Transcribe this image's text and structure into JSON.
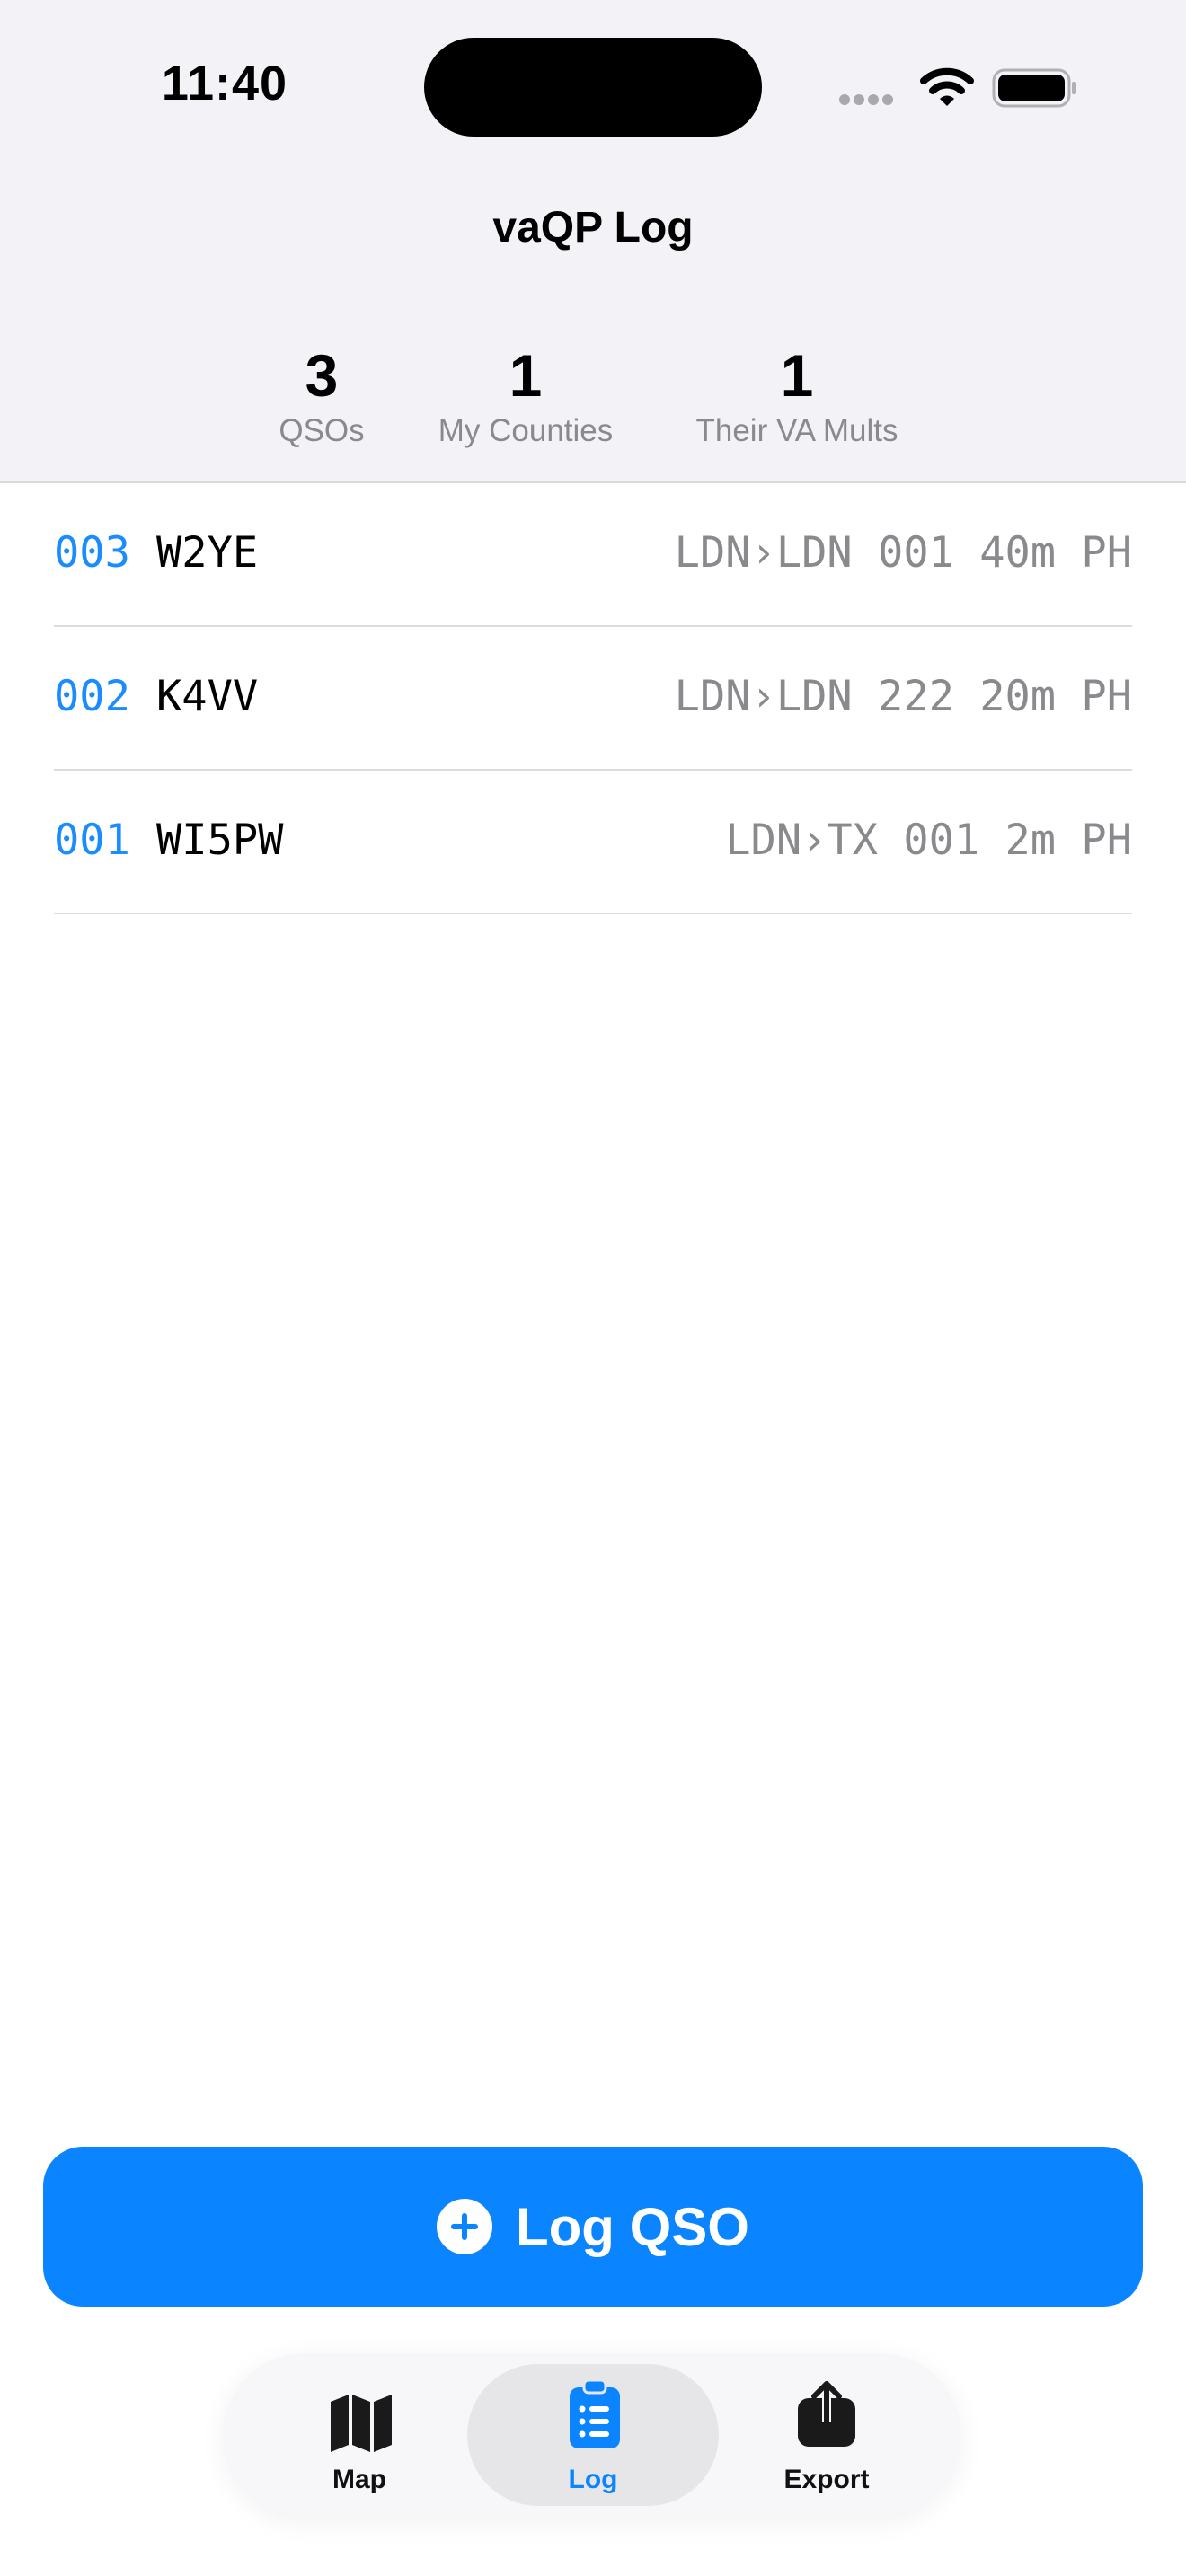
{
  "status_bar": {
    "time": "11:40"
  },
  "nav": {
    "title": "vaQP Log"
  },
  "stats": [
    {
      "value": "3",
      "label": "QSOs"
    },
    {
      "value": "1",
      "label": "My Counties"
    },
    {
      "value": "1",
      "label": "Their VA Mults"
    }
  ],
  "log": [
    {
      "serial": "003",
      "call": "W2YE",
      "detail": "LDN›LDN 001 40m PH"
    },
    {
      "serial": "002",
      "call": "K4VV",
      "detail": "LDN›LDN 222 20m PH"
    },
    {
      "serial": "001",
      "call": "WI5PW",
      "detail": "LDN›TX 001 2m PH"
    }
  ],
  "log_button": {
    "label": "Log QSO",
    "icon": "plus-circle-icon"
  },
  "tabs": [
    {
      "label": "Map",
      "icon": "map-icon",
      "active": false
    },
    {
      "label": "Log",
      "icon": "clipboard-list-icon",
      "active": true
    },
    {
      "label": "Export",
      "icon": "share-icon",
      "active": false
    }
  ],
  "colors": {
    "accent": "#0a84ff",
    "header_bg": "#f2f2f7",
    "secondary_text": "#8a8a8e"
  }
}
